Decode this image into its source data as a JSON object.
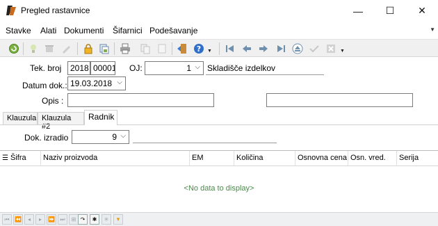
{
  "window": {
    "title": "Pregled rastavnice",
    "minimize": "—",
    "maximize": "☐",
    "close": "✕"
  },
  "menu": [
    "Stavke",
    "Alati",
    "Dokumenti",
    "Šifarnici",
    "Podešavanje"
  ],
  "form": {
    "tek_broj_label": "Tek. broj",
    "tek_broj_year": "2018",
    "tek_broj_number": "00001",
    "oj_label": "OJ:",
    "oj_value": "1",
    "oj_name": "Skladišče izdelkov",
    "datum_label": "Datum dok.:",
    "datum_value": "19.03.2018",
    "opis_label": "Opis :",
    "opis_value": "",
    "opis_extra_value": ""
  },
  "tabs": [
    "Klauzula",
    "Klauzula #2",
    "Radnik"
  ],
  "active_tab_index": 2,
  "radnik": {
    "dok_izradio_label": "Dok. izradio",
    "dok_izradio_value": "9",
    "dok_izradio_name": ""
  },
  "grid": {
    "columns": [
      "Šifra",
      "Naziv proizvoda",
      "EM",
      "Količina",
      "Osnovna cena",
      "Osn. vred.",
      "Serija"
    ],
    "empty_text": "<No data to display>"
  },
  "colors": {
    "accent_green": "#4a8a4a",
    "toolbar_bg": "#f0f0f0"
  }
}
